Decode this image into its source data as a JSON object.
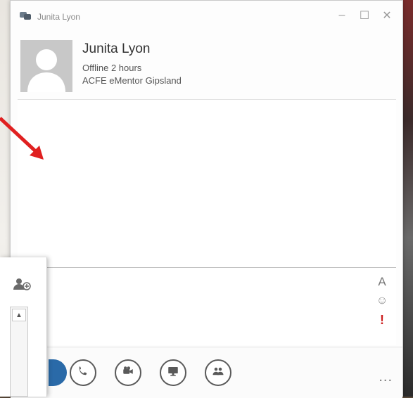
{
  "window": {
    "title": "Junita Lyon",
    "controls": [
      "minimize",
      "maximize",
      "close"
    ]
  },
  "contact": {
    "name": "Junita Lyon",
    "status": "Offline 2 hours",
    "organization": "ACFE eMentor Gipsland"
  },
  "compose_tools": {
    "font_label": "A",
    "emoji_icon": "emoji-icon",
    "important_label": "!"
  },
  "bottom_actions": [
    {
      "name": "call",
      "icon": "phone-icon"
    },
    {
      "name": "video",
      "icon": "video-camera-icon"
    },
    {
      "name": "present",
      "icon": "monitor-icon"
    },
    {
      "name": "participants",
      "icon": "people-icon"
    }
  ],
  "more_label": "...",
  "annotation": {
    "color": "#e02020"
  }
}
